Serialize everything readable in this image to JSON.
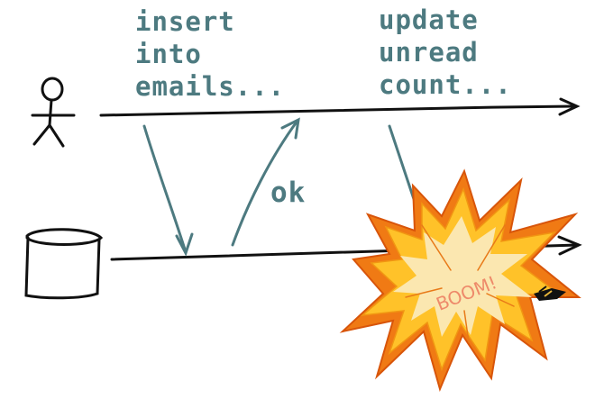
{
  "labels": {
    "insert": [
      "insert",
      "into",
      "emails..."
    ],
    "ok": "ok",
    "update": [
      "update",
      "unread",
      "count..."
    ],
    "boom": "BOOM!"
  },
  "colors": {
    "ink": "#111111",
    "arrow": "#4d7a80",
    "explosion_outer": "#f07a14",
    "explosion_mid": "#ffc229",
    "explosion_core": "#fbe7b0",
    "boom_text": "#ee8a6a"
  },
  "icons": {
    "actor": "stick-figure-icon",
    "database": "database-cylinder-icon",
    "explosion": "explosion-icon"
  }
}
